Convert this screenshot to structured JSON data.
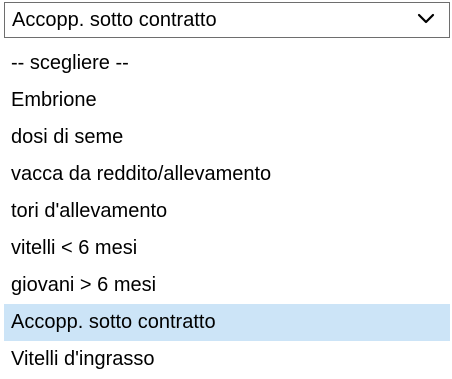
{
  "select": {
    "value": "Accopp. sotto contratto",
    "icon": "chevron-down-icon"
  },
  "options": [
    {
      "label": "-- scegliere --"
    },
    {
      "label": "Embrione"
    },
    {
      "label": "dosi di seme"
    },
    {
      "label": "vacca da reddito/allevamento"
    },
    {
      "label": "tori d'allevamento"
    },
    {
      "label": "vitelli < 6 mesi"
    },
    {
      "label": "giovani > 6 mesi"
    },
    {
      "label": "Accopp. sotto contratto",
      "selected": true
    },
    {
      "label": "Vitelli d'ingrasso"
    }
  ],
  "colors": {
    "selected_background": "#cce4f7",
    "border": "#6e6e6e"
  }
}
